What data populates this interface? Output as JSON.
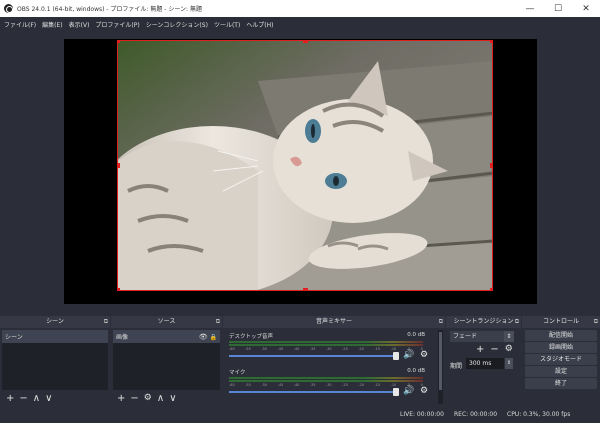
{
  "window": {
    "title": "OBS 24.0.1 (64-bit, windows) - プロファイル: 無題 - シーン: 無題",
    "minimize_glyph": "—",
    "maximize_glyph": "☐",
    "close_glyph": "✕"
  },
  "menu": [
    "ファイル(F)",
    "編集(E)",
    "表示(V)",
    "プロファイル(P)",
    "シーンコレクション(S)",
    "ツール(T)",
    "ヘルプ(H)"
  ],
  "preview": {
    "selection_color": "#e21f1f",
    "source_image": "cat lying on wooden planks"
  },
  "docks": {
    "scenes": {
      "title": "シーン",
      "items": [
        "シーン"
      ],
      "toolbar": [
        "+",
        "−",
        "∧",
        "∨"
      ]
    },
    "sources": {
      "title": "ソース",
      "items": [
        "画像"
      ],
      "item_icons": [
        "eye-icon",
        "lock-icon"
      ],
      "toolbar": [
        "+",
        "−",
        "⚙",
        "∧",
        "∨"
      ]
    },
    "mixer": {
      "title": "音声ミキサー",
      "tracks": [
        {
          "name": "デスクトップ音声",
          "level": "0.0 dB"
        },
        {
          "name": "マイク",
          "level": "0.0 dB"
        }
      ],
      "tick_labels": [
        "-60",
        "-55",
        "-50",
        "-45",
        "-40",
        "-35",
        "-30",
        "-25",
        "-20",
        "-15",
        "-10",
        "-5",
        "0"
      ]
    },
    "transitions": {
      "title": "シーントランジション",
      "selected": "フェード",
      "duration_label": "期間",
      "duration_value": "300 ms"
    },
    "controls": {
      "title": "コントロール",
      "buttons": [
        "配信開始",
        "録画開始",
        "スタジオモード",
        "設定",
        "終了"
      ]
    }
  },
  "status": {
    "live": "LIVE: 00:00:00",
    "rec": "REC: 00:00:00",
    "cpu": "CPU: 0.3%, 30.00 fps"
  }
}
